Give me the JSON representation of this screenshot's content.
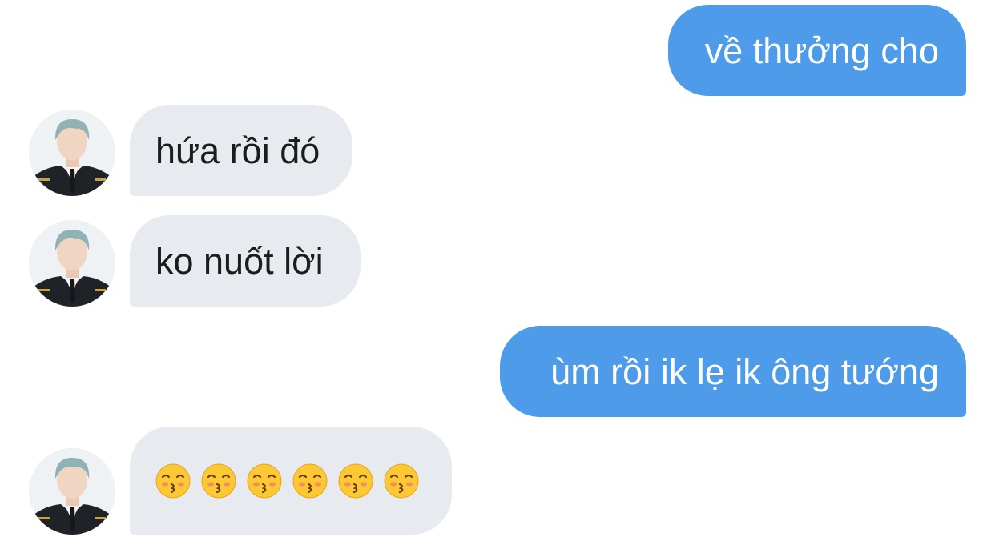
{
  "messages": [
    {
      "direction": "out",
      "text": "về thưởng cho"
    },
    {
      "direction": "in",
      "text": "hứa rồi đó"
    },
    {
      "direction": "in",
      "text": "ko nuốt lời"
    },
    {
      "direction": "out",
      "text": "ùm rồi ik lẹ ik ông tướng"
    },
    {
      "direction": "in",
      "emoji": "kissing-face-with-closed-eyes",
      "emoji_count": 6
    }
  ],
  "colors": {
    "outgoing_bubble": "#4e9ce9",
    "incoming_bubble": "#e7ebef",
    "background": "#ffffff"
  }
}
